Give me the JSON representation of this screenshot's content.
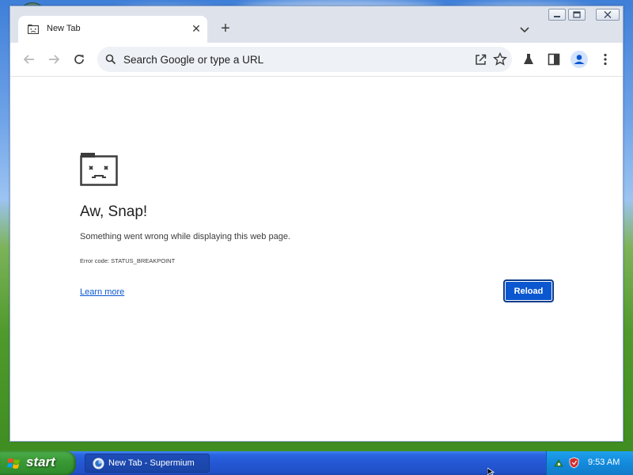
{
  "browser": {
    "tab": {
      "title": "New Tab",
      "close_glyph": "✕",
      "favicon": "sad-tab-favicon"
    },
    "new_tab_glyph": "+",
    "omnibox": {
      "placeholder": "Search Google or type a URL",
      "value": ""
    },
    "toolbar_icons": [
      "back-icon",
      "forward-icon",
      "reload-icon",
      "share-icon",
      "star-icon",
      "labs-icon",
      "side-panel-icon",
      "profile-icon",
      "menu-icon"
    ],
    "caption_buttons": [
      "minimize-icon",
      "restore-icon",
      "close-icon"
    ]
  },
  "page": {
    "title": "Aw, Snap!",
    "message": "Something went wrong while displaying this web page.",
    "error_code": "Error code: STATUS_BREAKPOINT",
    "learn_more": "Learn more",
    "reload_label": "Reload"
  },
  "taskbar": {
    "start_label": "start",
    "task_label": "New Tab - Supermium",
    "clock": "9:53 AM",
    "tray_icons": [
      "network-icon",
      "security-shield-icon"
    ]
  },
  "colors": {
    "accent": "#0b57d0",
    "tabstrip": "#dee3eb",
    "omnibox": "#eef1f6",
    "taskbar": "#2457d4",
    "start_green": "#3a9a36"
  }
}
